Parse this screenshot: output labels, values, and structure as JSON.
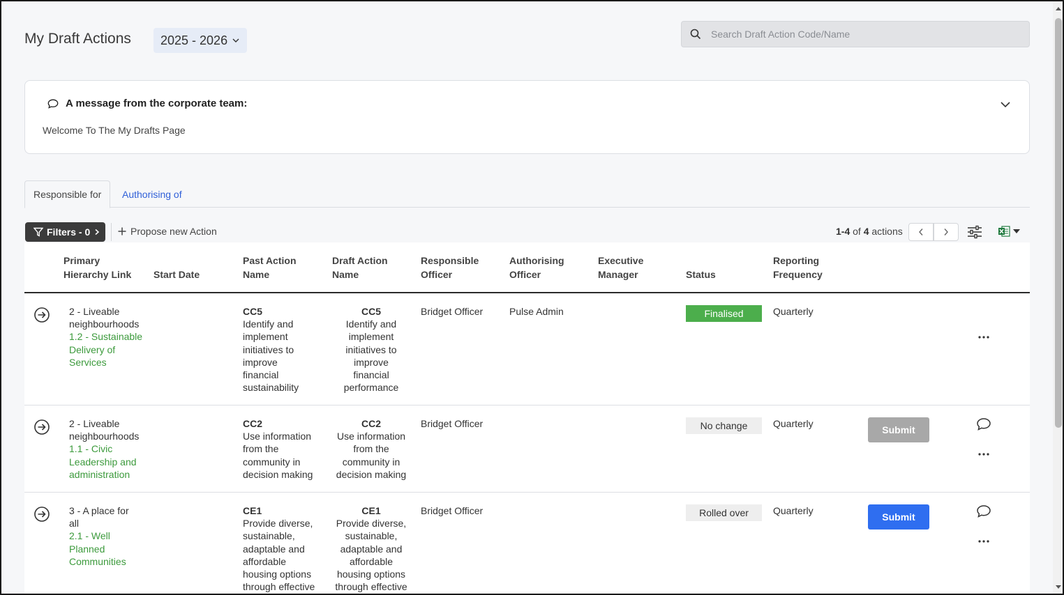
{
  "header": {
    "title": "My Draft Actions",
    "year": "2025 - 2026",
    "search_placeholder": "Search Draft Action Code/Name"
  },
  "message": {
    "title": "A message from the corporate team:",
    "body": "Welcome To The My Drafts Page"
  },
  "tabs": [
    {
      "label": "Responsible for",
      "active": true
    },
    {
      "label": "Authorising of",
      "active": false
    }
  ],
  "toolbar": {
    "filters_label": "Filters - 0",
    "propose_label": "Propose new Action",
    "pager_range": "1-4",
    "pager_of": "of",
    "pager_total": "4",
    "pager_unit": "actions"
  },
  "columns": {
    "primary_1": "Primary",
    "primary_2": "Hierarchy Link",
    "start_date": "Start Date",
    "past_1": "Past Action",
    "past_2": "Name",
    "draft_1": "Draft Action",
    "draft_2": "Name",
    "resp_1": "Responsible",
    "resp_2": "Officer",
    "auth_1": "Authorising",
    "auth_2": "Officer",
    "exec_1": "Executive",
    "exec_2": "Manager",
    "status": "Status",
    "freq_1": "Reporting",
    "freq_2": "Frequency"
  },
  "rows": [
    {
      "hier_1": "2 - Liveable",
      "hier_2": "neighbourhoods",
      "link_1": "1.2 - Sustainable",
      "link_2": "Delivery of",
      "link_3": "Services",
      "past_code": "CC5",
      "past_lines": [
        "Identify and",
        "implement",
        "initiatives to",
        "improve",
        "financial",
        "sustainability"
      ],
      "draft_code": "CC5",
      "draft_lines": [
        "Identify and",
        "implement",
        "initiatives to",
        "improve",
        "financial",
        "performance"
      ],
      "responsible": "Bridget Officer",
      "authorising": "Pulse Admin",
      "status": "Finalised",
      "frequency": "Quarterly"
    },
    {
      "hier_1": "2 - Liveable",
      "hier_2": "neighbourhoods",
      "link_1": "1.1 - Civic",
      "link_2": "Leadership and",
      "link_3": "administration",
      "past_code": "CC2",
      "past_lines": [
        "Use information",
        "from the",
        "community in",
        "decision making"
      ],
      "draft_code": "CC2",
      "draft_lines": [
        "Use information",
        "from the",
        "community in",
        "decision making"
      ],
      "responsible": "Bridget Officer",
      "status": "No change",
      "frequency": "Quarterly",
      "submit": "Submit"
    },
    {
      "hier_1": "3 - A place for",
      "hier_2": "all",
      "link_1": "2.1 - Well",
      "link_2": "Planned",
      "link_3": "Communities",
      "past_code": "CE1",
      "past_lines": [
        "Provide diverse,",
        "sustainable,",
        "adaptable and",
        "affordable",
        "housing options",
        "through effective"
      ],
      "draft_code": "CE1",
      "draft_lines": [
        "Provide diverse,",
        "sustainable,",
        "adaptable and",
        "affordable",
        "housing options",
        "through effective"
      ],
      "responsible": "Bridget Officer",
      "status": "Rolled over",
      "frequency": "Quarterly",
      "submit": "Submit"
    }
  ],
  "colors": {
    "accent": "#2f6ef0",
    "finalised": "#4cae4c",
    "link_green": "#3c9a3c",
    "link_blue": "#2f5fd8"
  }
}
